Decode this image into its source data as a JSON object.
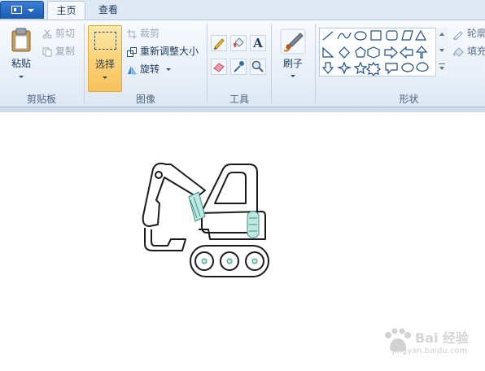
{
  "tabs": [
    {
      "label": "主页",
      "active": true
    },
    {
      "label": "查看",
      "active": false
    }
  ],
  "clipboard": {
    "group_label": "剪贴板",
    "paste_label": "粘贴",
    "cut_label": "剪切",
    "copy_label": "复制"
  },
  "image": {
    "group_label": "图像",
    "select_label": "选择",
    "crop_label": "裁剪",
    "resize_label": "重新调整大小",
    "rotate_label": "旋转"
  },
  "tools": {
    "group_label": "工具",
    "items": [
      "pencil-icon",
      "fill-icon",
      "text-icon",
      "eraser-icon",
      "color-picker-icon",
      "magnifier-icon"
    ],
    "text_glyph": "A"
  },
  "brushes": {
    "label": "刷子"
  },
  "shapes": {
    "group_label": "形状",
    "outline_label": "轮廓",
    "fill_label": "填充"
  },
  "watermark": {
    "text": "Bai 经验",
    "sub": "jingyan.baidu.com"
  },
  "colors": {
    "accent": "#1c5bb5",
    "select_highlight": "#fbd37a",
    "ribbon_bg": "#e6eef8"
  }
}
